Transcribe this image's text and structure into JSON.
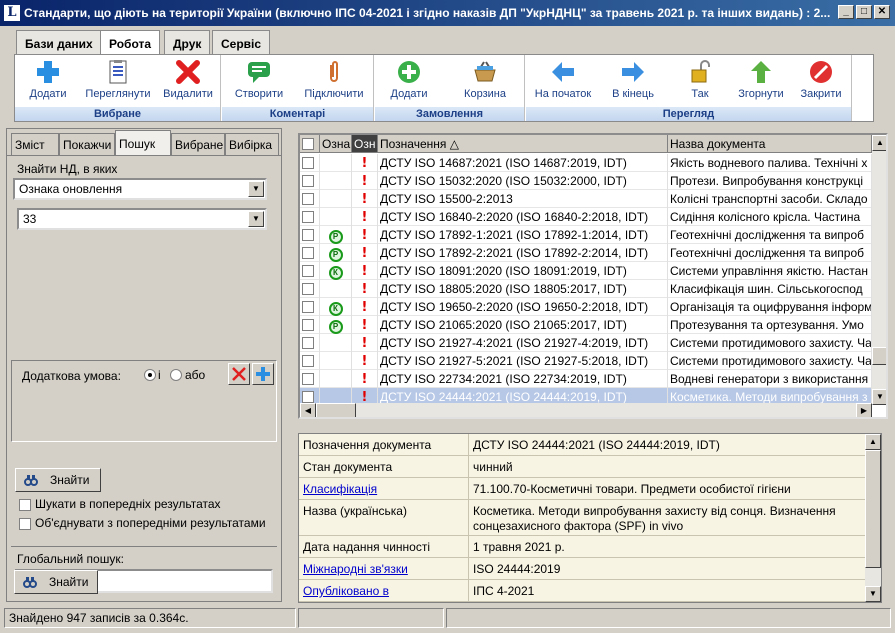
{
  "window": {
    "title": "Стандарти, що діють на території України (включно ІПС 04-2021 і згідно наказів ДП \"УкрНДНЦ\" за травень 2021 р. та інших видань) : 2..."
  },
  "ribbon": {
    "tabs": [
      "Бази даних",
      "Робота",
      "Друк",
      "Сервіс"
    ],
    "groups": [
      {
        "title": "Вибране",
        "buttons": [
          "Додати",
          "Переглянути",
          "Видалити"
        ]
      },
      {
        "title": "Коментарі",
        "buttons": [
          "Створити",
          "Підключити"
        ]
      },
      {
        "title": "Замовлення",
        "buttons": [
          "Додати",
          "Корзина"
        ]
      },
      {
        "title": "Перегляд",
        "buttons": [
          "На початок",
          "В кінець",
          "Так",
          "Згорнути",
          "Закрити"
        ]
      }
    ]
  },
  "left": {
    "tabs": [
      "Зміст",
      "Покажчи",
      "Пошук",
      "Вибране",
      "Вибірка"
    ],
    "find_label": "Знайти НД, в яких",
    "field_combo": "Ознака оновлення",
    "value_combo": "33",
    "extra_cond_label": "Додаткова умова:",
    "radio_and": "і",
    "radio_or": "або",
    "find_button": "Знайти",
    "search_prev": "Шукати в попередніх результатах",
    "merge_prev": "Об'єднувати з попередніми результатами",
    "global_label": "Глобальний пошук:",
    "global_value": "",
    "global_button": "Знайти"
  },
  "grid": {
    "headers": [
      "",
      "Озна",
      "Озн",
      "Позначення",
      "Назва документа"
    ],
    "rows": [
      {
        "badge": "",
        "code": "ДСТУ ISO 14687:2021 (ISO 14687:2019, IDT)",
        "name": "Якість водневого палива. Технічні х"
      },
      {
        "badge": "",
        "code": "ДСТУ ISO 15032:2020 (ISO 15032:2000, IDT)",
        "name": "Протези. Випробування конструкці"
      },
      {
        "badge": "",
        "code": "ДСТУ ISO 15500-2:2013",
        "name": "Колісні транспортні засоби. Складо"
      },
      {
        "badge": "",
        "code": "ДСТУ ISO 16840-2:2020 (ISO 16840-2:2018, IDT)",
        "name": "Сидіння колісного крісла. Частина"
      },
      {
        "badge": "Р",
        "code": "ДСТУ ISO 17892-1:2021 (ISO 17892-1:2014, IDT)",
        "name": "Геотехнічні дослідження та випроб"
      },
      {
        "badge": "Р",
        "code": "ДСТУ ISO 17892-2:2021 (ISO 17892-2:2014, IDT)",
        "name": "Геотехнічні дослідження та випроб"
      },
      {
        "badge": "К",
        "code": "ДСТУ ISO 18091:2020 (ISO 18091:2019, IDT)",
        "name": "Системи управління якістю. Настан"
      },
      {
        "badge": "",
        "code": "ДСТУ ISO 18805:2020 (ISO 18805:2017, IDT)",
        "name": "Класифікація шин. Сільськогоспод"
      },
      {
        "badge": "К",
        "code": "ДСТУ ISO 19650-2:2020 (ISO 19650-2:2018, IDT)",
        "name": "Організація та оцифрування інформ"
      },
      {
        "badge": "Р",
        "code": "ДСТУ ISO 21065:2020 (ISO 21065:2017, IDT)",
        "name": "Протезування та ортезування. Умо"
      },
      {
        "badge": "",
        "code": "ДСТУ ISO 21927-4:2021 (ISO 21927-4:2019, IDT)",
        "name": "Системи протидимового захисту. Ча"
      },
      {
        "badge": "",
        "code": "ДСТУ ISO 21927-5:2021 (ISO 21927-5:2018, IDT)",
        "name": "Системи протидимового захисту. Ча"
      },
      {
        "badge": "",
        "code": "ДСТУ ISO 22734:2021 (ISO 22734:2019, IDT)",
        "name": "Водневі генератори з використання"
      },
      {
        "badge": "",
        "code": "ДСТУ ISO 24444:2021 (ISO 24444:2019, IDT)",
        "name": "Косметика. Методи випробування з"
      }
    ]
  },
  "detail": {
    "rows": [
      {
        "key": "Позначення документа",
        "value": "ДСТУ ISO 24444:2021 (ISO 24444:2019, IDT)",
        "link": false
      },
      {
        "key": "Стан документа",
        "value": "чинний",
        "link": false
      },
      {
        "key": "Класифікація",
        "value": "71.100.70-Косметичні товари. Предмети особистої гігієни",
        "link": true
      },
      {
        "key": "Назва (українська)",
        "value": "Косметика. Методи випробування захисту від сонця. Визначення сонцезахисного фактора (SPF) in vivo",
        "link": false
      },
      {
        "key": "Дата надання чинності",
        "value": "1 травня 2021 р.",
        "link": false
      },
      {
        "key": "Міжнародні зв'язки",
        "value": "ISO 24444:2019",
        "link": true
      },
      {
        "key": "Опубліковано в",
        "value": "ІПС 4-2021",
        "link": true
      }
    ]
  },
  "status": {
    "text": "Знайдено 947 записів за 0.364с."
  }
}
